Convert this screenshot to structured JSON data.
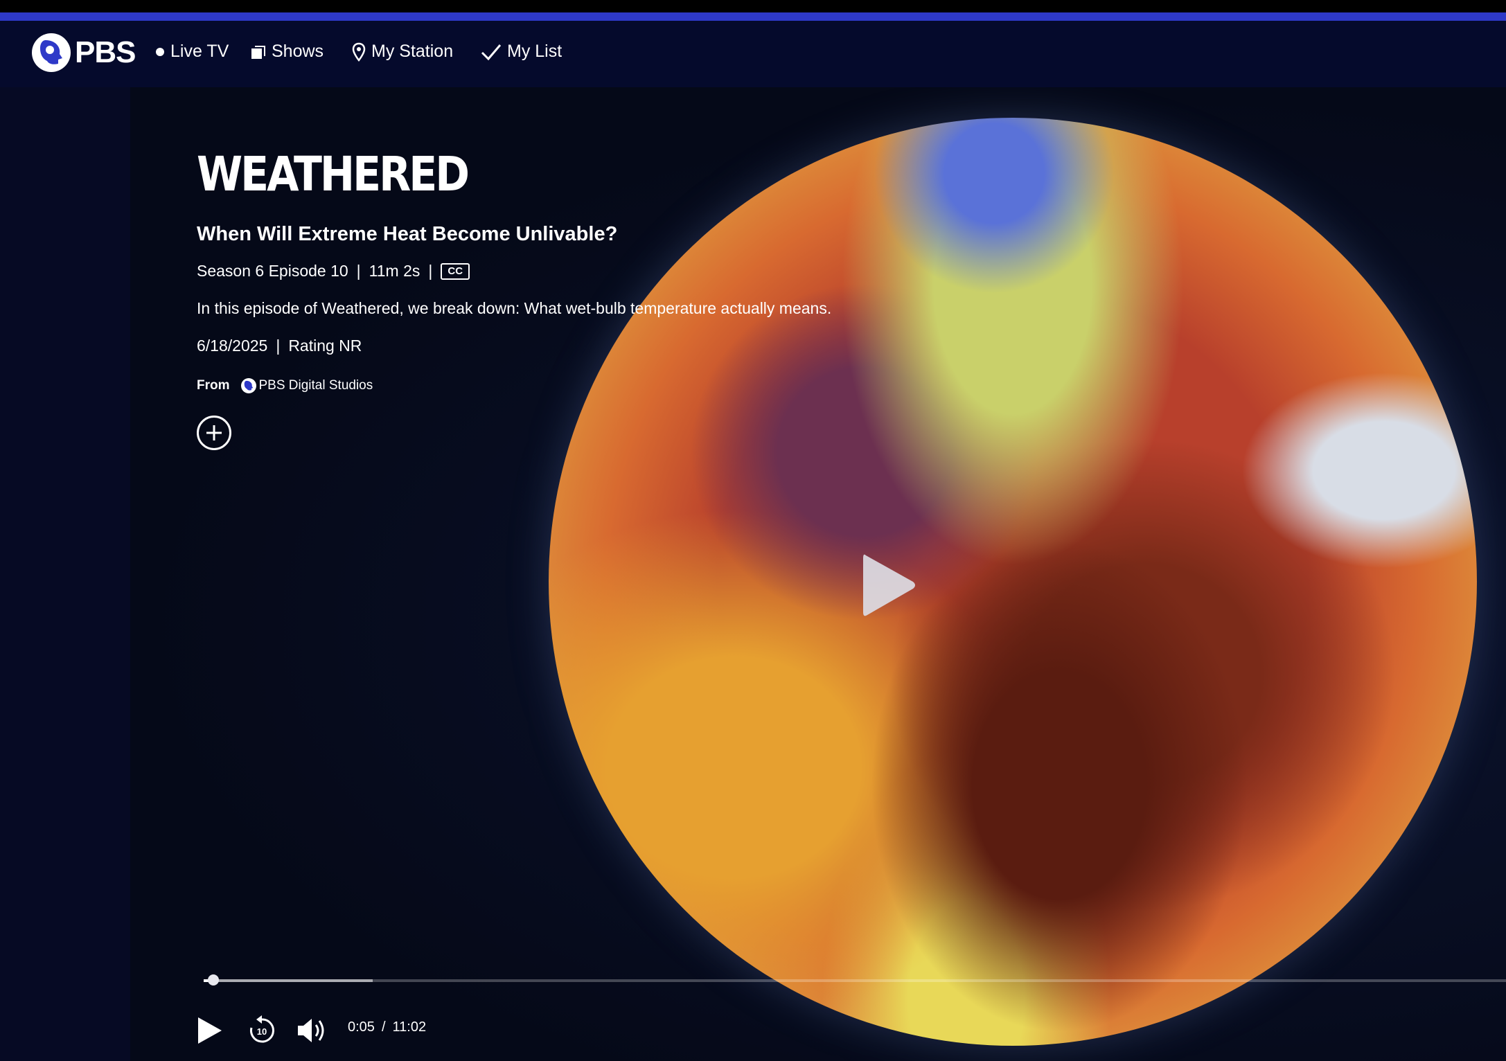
{
  "nav": {
    "brand": "PBS",
    "items": [
      {
        "label": "Live TV",
        "icon": "live-dot-icon"
      },
      {
        "label": "Shows",
        "icon": "shows-icon"
      },
      {
        "label": "My Station",
        "icon": "location-pin-icon"
      },
      {
        "label": "My List",
        "icon": "checkmark-icon"
      }
    ]
  },
  "episode": {
    "show_logo": "WEATHERED",
    "title": "When Will Extreme Heat Become Unlivable?",
    "season_episode": "Season 6 Episode 10",
    "duration": "11m 2s",
    "cc": "CC",
    "description": "In this episode of Weathered, we break down: What wet-bulb temperature actually means.",
    "date": "6/18/2025",
    "rating": "Rating NR",
    "from_label": "From",
    "station": "PBS Digital Studios",
    "separator": "|"
  },
  "player": {
    "current_time": "0:05",
    "time_separator": "/",
    "total_time": "11:02",
    "progress_fraction": 0.0075,
    "buffered_fraction": 0.13,
    "skip_back_seconds": "10"
  },
  "colors": {
    "accent_bar": "#2e39c8",
    "navbar_bg": "#050a2c",
    "page_bg": "#070b22"
  }
}
